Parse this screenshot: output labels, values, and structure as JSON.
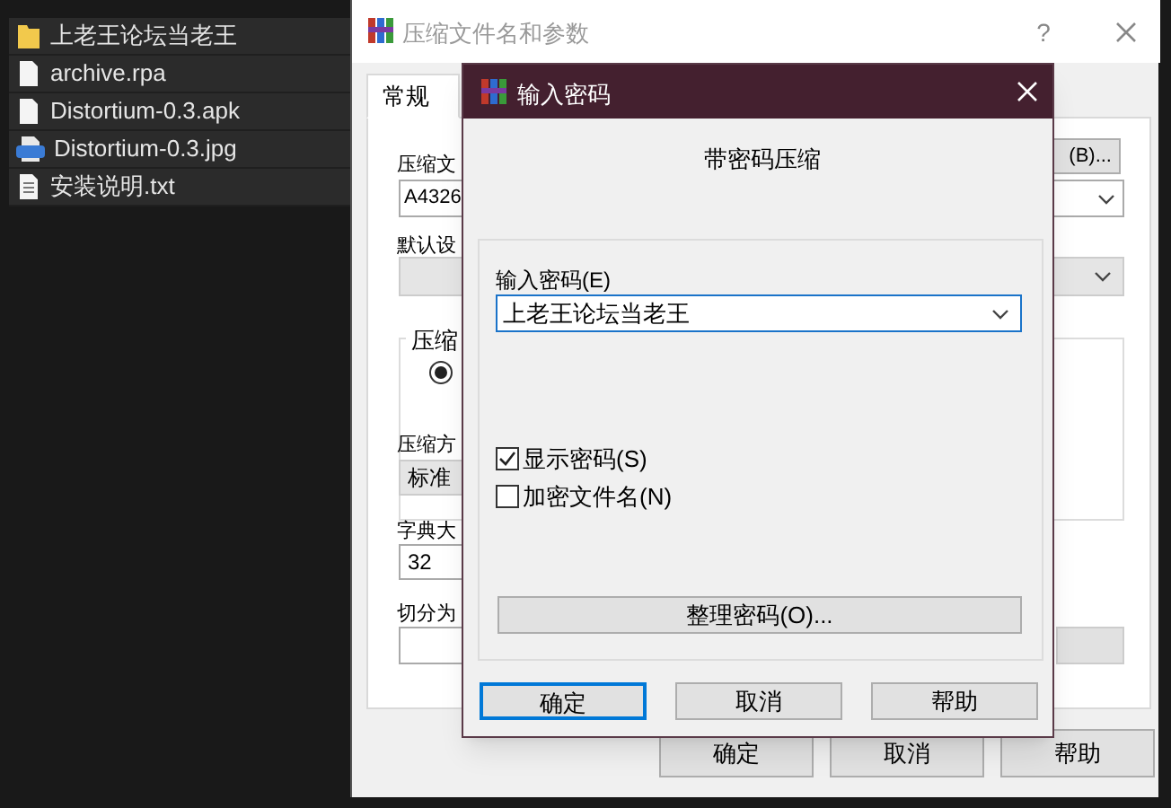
{
  "file_list": [
    {
      "name": "上老王论坛当老王",
      "kind": "folder"
    },
    {
      "name": "archive.rpa",
      "kind": "file"
    },
    {
      "name": "Distortium-0.3.apk",
      "kind": "file"
    },
    {
      "name": "Distortium-0.3.jpg",
      "kind": "image"
    },
    {
      "name": "安装说明.txt",
      "kind": "text"
    }
  ],
  "archive_window": {
    "title": "压缩文件名和参数",
    "help_glyph": "?",
    "tabs": [
      {
        "label": "常规",
        "selected": true
      }
    ],
    "archive_name_label": "压缩文",
    "archive_name_value": "A4326",
    "browse_button": "(B)...",
    "profile_label": "默认设",
    "format_group_label": "压缩",
    "format_radio": {
      "checked": true
    },
    "method_label": "压缩方",
    "method_value": "标准",
    "dictionary_label": "字典大",
    "dictionary_value": "32",
    "split_label": "切分为",
    "buttons": [
      "确定",
      "取消",
      "帮助"
    ]
  },
  "password_dialog": {
    "title": "输入密码",
    "heading": "带密码压缩",
    "password_label": "输入密码(E)",
    "password_value": "上老王论坛当老王",
    "checkboxes": [
      {
        "label": "显示密码(S)",
        "checked": true
      },
      {
        "label": "加密文件名(N)",
        "checked": false
      }
    ],
    "organize_button": "整理密码(O)...",
    "buttons": [
      {
        "label": "确定",
        "default": true
      },
      {
        "label": "取消",
        "default": false
      },
      {
        "label": "帮助",
        "default": false
      }
    ]
  }
}
